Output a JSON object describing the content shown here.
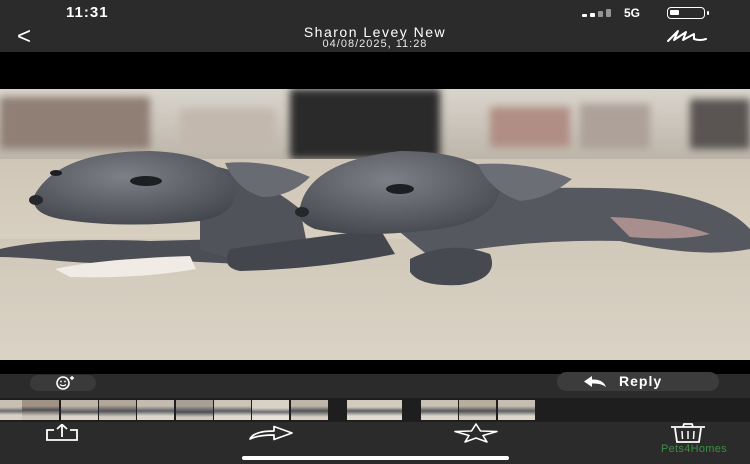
{
  "status_bar": {
    "time": "11:31",
    "network": "5G",
    "battery_level": 0.3
  },
  "header": {
    "back": "<",
    "title": "Sharon Levey New",
    "subtitle": "04/08/2025, 11:28"
  },
  "photo": {
    "subject": "two grey puppies lying on a beige carpet"
  },
  "actions": {
    "reply_label": "Reply"
  },
  "thumbnails": {
    "count": 13
  },
  "toolbar": {
    "share": "share-icon",
    "forward": "forward-icon",
    "star": "star-icon",
    "delete": "trash-icon"
  },
  "watermark": "Pets4Homes",
  "colors": {
    "bar": "#2b2b2b",
    "stage": "#000000",
    "pill": "#3c3c3c",
    "watermark": "#3a8f46"
  }
}
